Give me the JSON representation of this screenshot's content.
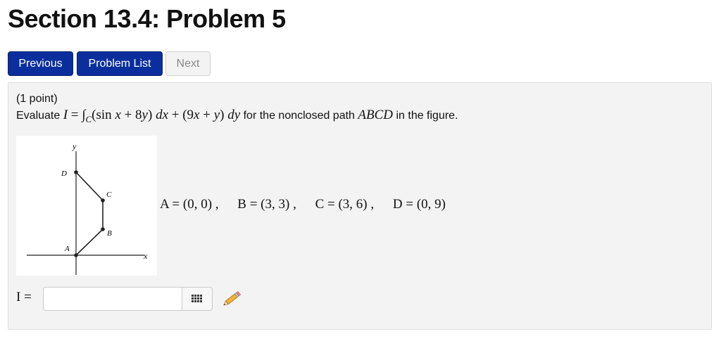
{
  "page": {
    "title": "Section 13.4: Problem 5"
  },
  "nav": {
    "previous": "Previous",
    "problem_list": "Problem List",
    "next": "Next"
  },
  "problem": {
    "points": "(1 point)",
    "prefix": "Evaluate",
    "suffix_text": "for the nonclosed path",
    "path_name": "ABCD",
    "suffix_end": "in the figure.",
    "vertex_coordinates": [
      "A = (0, 0) ,",
      "B = (3, 3) ,",
      "C = (3, 6) ,",
      "D = (0, 9)"
    ]
  },
  "figure": {
    "axis_x": "x",
    "axis_y": "y",
    "vertices": {
      "A": "A",
      "B": "B",
      "C": "C",
      "D": "D"
    }
  },
  "answer": {
    "label": "I =",
    "value": "",
    "placeholder": ""
  },
  "icons": {
    "keypad": "keypad-icon",
    "pencil": "pencil-icon"
  },
  "colors": {
    "button_primary": "#0a2f9d",
    "panel_background": "#f3f3f3"
  }
}
